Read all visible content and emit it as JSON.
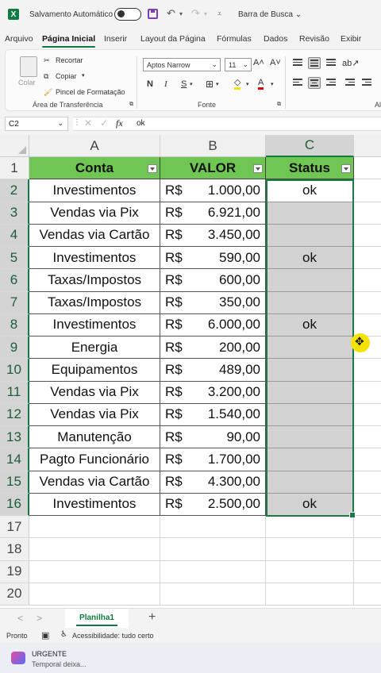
{
  "titlebar": {
    "app_letter": "X",
    "autosave_label": "Salvamento Automático",
    "search_label": "Barra de Busca"
  },
  "menu": [
    "Arquivo",
    "Página Inicial",
    "Inserir",
    "Layout da Página",
    "Fórmulas",
    "Dados",
    "Revisão",
    "Exibir"
  ],
  "ribbon": {
    "paste_label": "Colar",
    "cut_label": "Recortar",
    "copy_label": "Copiar",
    "format_painter_label": "Pincel de Formatação",
    "clipboard_group": "Área de Transferência",
    "font_name": "Aptos Narrow",
    "font_size": "11",
    "grow_font": "A˄",
    "shrink_font": "A˅",
    "bold": "N",
    "italic": "I",
    "underline": "S",
    "font_group": "Fonte",
    "overflow_group": "Al"
  },
  "formula_bar": {
    "cell_ref": "C2",
    "fx_label": "fx",
    "value": "ok"
  },
  "columns": [
    "A",
    "B",
    "C"
  ],
  "row_numbers": [
    "1",
    "2",
    "3",
    "4",
    "5",
    "6",
    "7",
    "8",
    "9",
    "10",
    "11",
    "12",
    "13",
    "14",
    "15",
    "16",
    "17",
    "18",
    "19",
    "20"
  ],
  "table": {
    "headers": [
      "Conta",
      "VALOR",
      "Status"
    ],
    "currency": "R$",
    "rows": [
      {
        "conta": "Investimentos",
        "valor": "1.000,00",
        "status": "ok"
      },
      {
        "conta": "Vendas via Pix",
        "valor": "6.921,00",
        "status": ""
      },
      {
        "conta": "Vendas via Cartão",
        "valor": "3.450,00",
        "status": ""
      },
      {
        "conta": "Investimentos",
        "valor": "590,00",
        "status": "ok"
      },
      {
        "conta": "Taxas/Impostos",
        "valor": "600,00",
        "status": ""
      },
      {
        "conta": "Taxas/Impostos",
        "valor": "350,00",
        "status": ""
      },
      {
        "conta": "Investimentos",
        "valor": "6.000,00",
        "status": "ok"
      },
      {
        "conta": "Energia",
        "valor": "200,00",
        "status": ""
      },
      {
        "conta": "Equipamentos",
        "valor": "489,00",
        "status": ""
      },
      {
        "conta": "Vendas via Pix",
        "valor": "3.200,00",
        "status": ""
      },
      {
        "conta": "Vendas via Pix",
        "valor": "1.540,00",
        "status": ""
      },
      {
        "conta": "Manutenção",
        "valor": "90,00",
        "status": ""
      },
      {
        "conta": "Pagto Funcionário",
        "valor": "1.700,00",
        "status": ""
      },
      {
        "conta": "Vendas via Cartão",
        "valor": "4.300,00",
        "status": ""
      },
      {
        "conta": "Investimentos",
        "valor": "2.500,00",
        "status": "ok"
      }
    ]
  },
  "sheet_tabs": {
    "active": "Planilha1",
    "add": "+",
    "prev": "<",
    "next": ">"
  },
  "statusbar": {
    "mode": "Pronto",
    "accessibility": "Acessibilidade: tudo certo"
  },
  "notification": {
    "title": "URGENTE",
    "subtitle": "Temporal deixa..."
  },
  "colors": {
    "header_fill": "#70c653",
    "status_fill": "#d2d2d2",
    "excel_green": "#107c41",
    "cursor_highlight": "#f5e200"
  }
}
